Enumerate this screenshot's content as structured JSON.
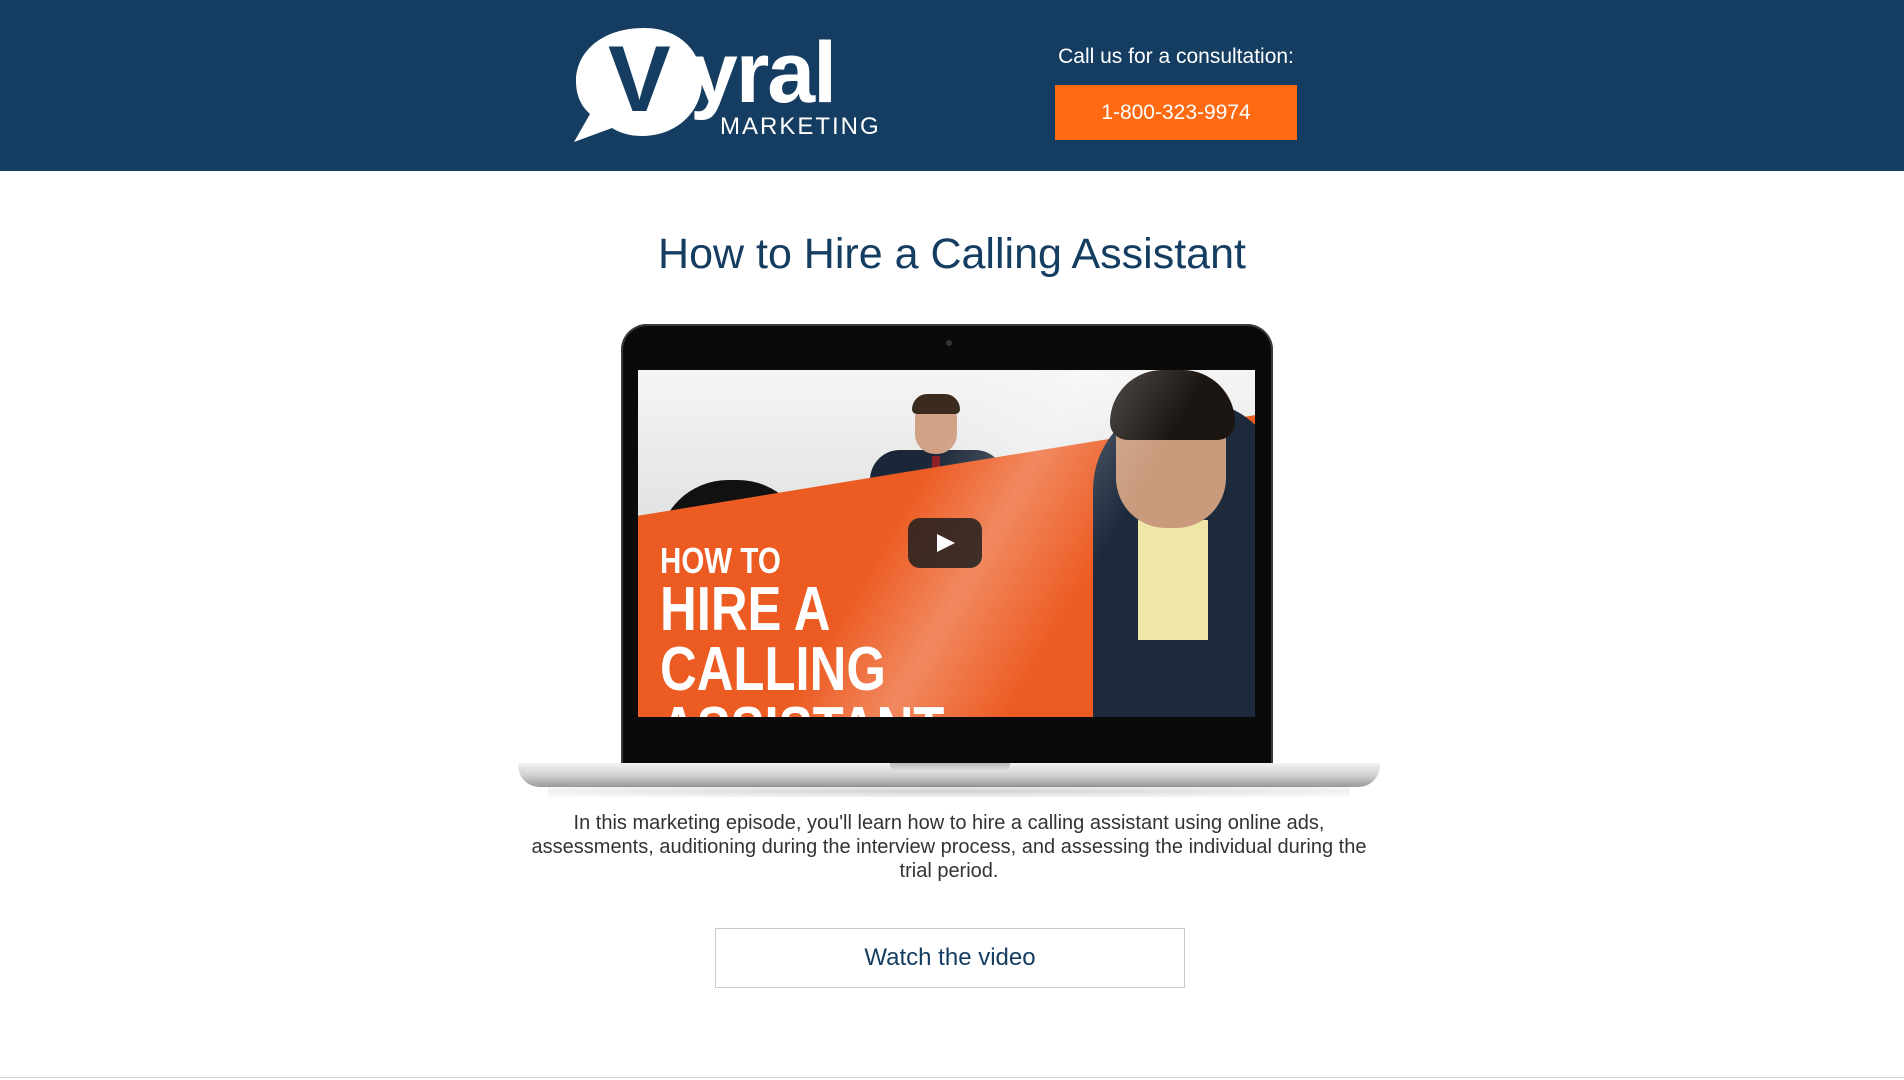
{
  "header": {
    "logo": {
      "word": "yral",
      "letter": "V",
      "sub": "MARKETING"
    },
    "cta_label": "Call us for a consultation:",
    "phone": "1-800-323-9974"
  },
  "main": {
    "title": "How to Hire a Calling Assistant",
    "video": {
      "title_line1": "HOW TO",
      "title_line2": "HIRE A CALLING",
      "title_line3": "ASSISTANT"
    },
    "description": "In this marketing episode, you'll learn how to hire a calling assistant using online ads, assessments, auditioning during the interview process, and assessing the individual during the trial period.",
    "watch_label": "Watch the video"
  },
  "colors": {
    "header_bg": "#143d61",
    "accent": "#ff6a13",
    "title": "#143d61"
  },
  "icons": [
    "speech-bubble-logo-icon",
    "play-icon"
  ]
}
